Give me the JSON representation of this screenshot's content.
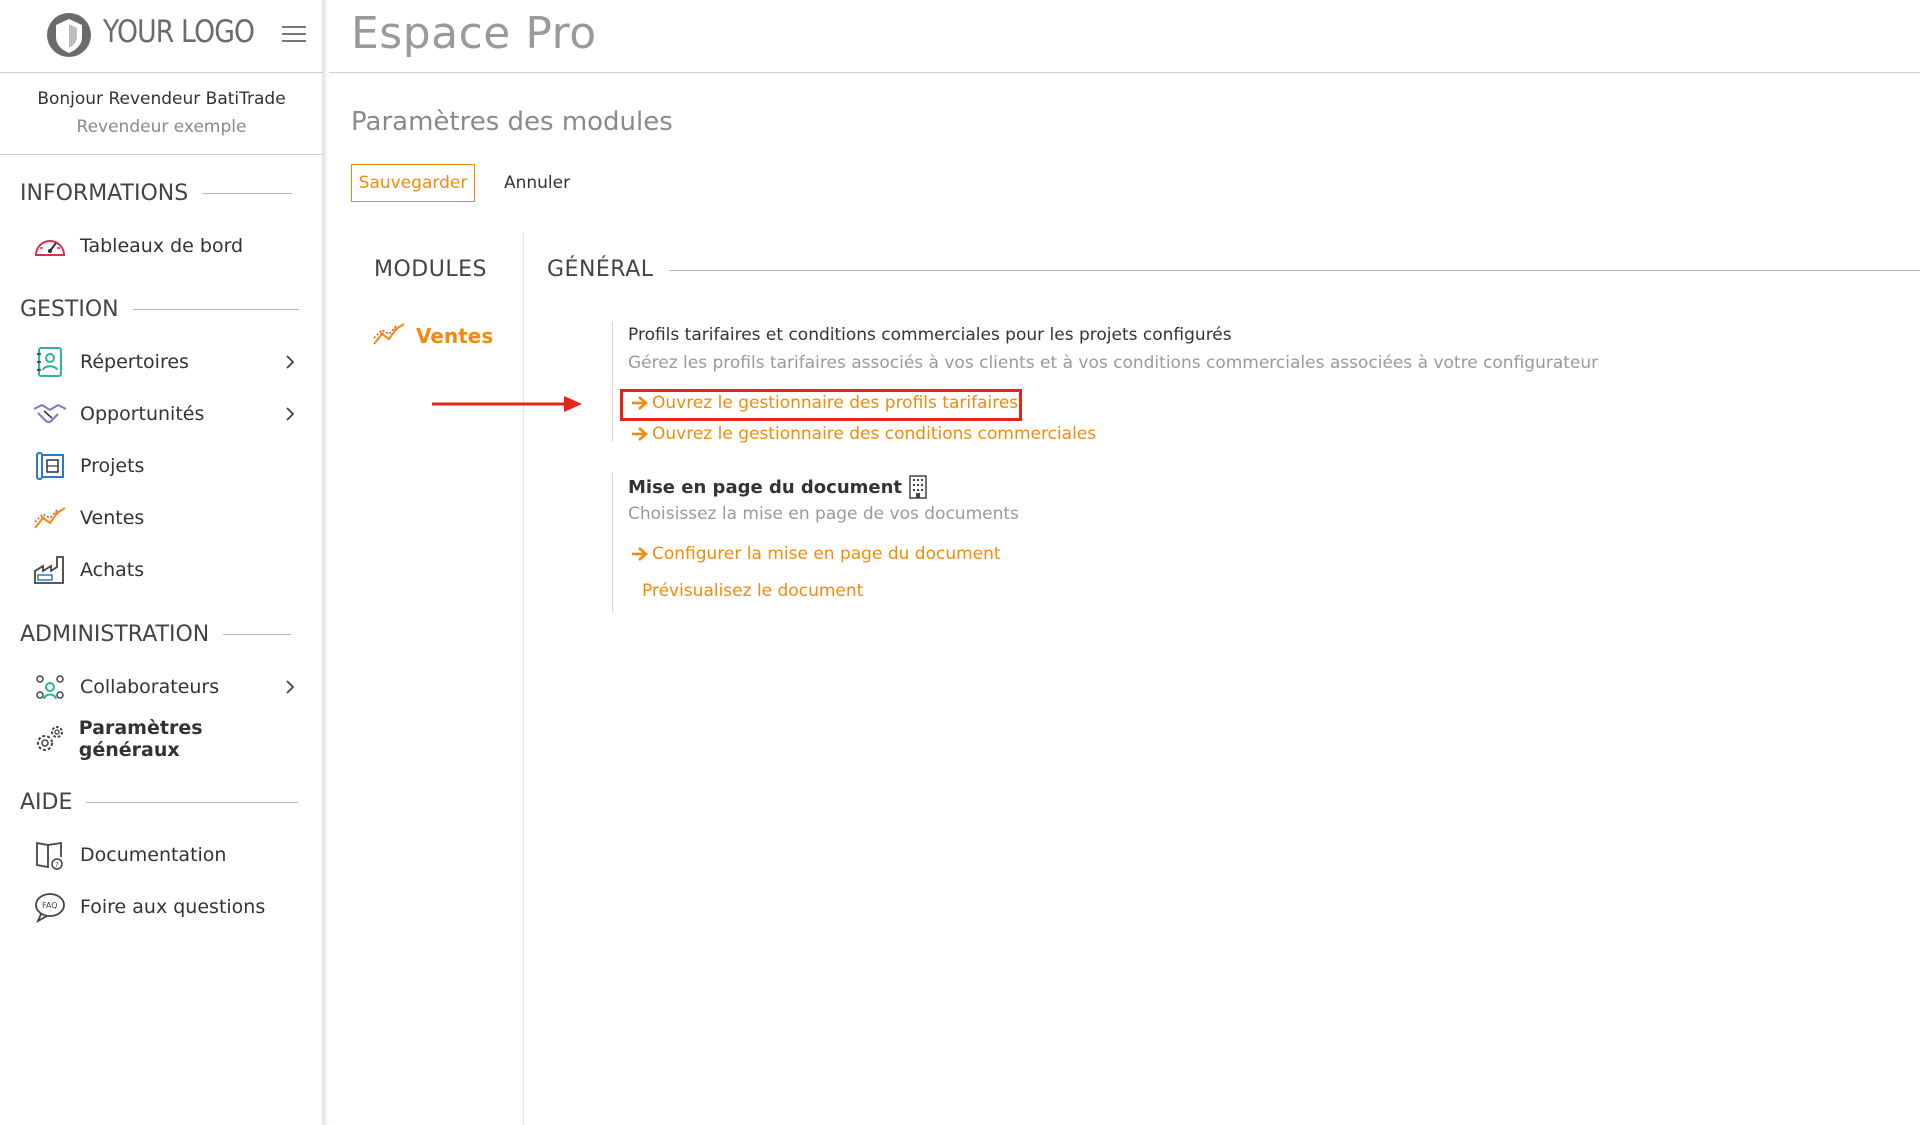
{
  "brand": {
    "logo_text": "YOUR LOGO",
    "logo_mark_color": "#6b6b6b",
    "accent_color": "#f28b0c",
    "highlight_color": "#e8241a"
  },
  "header": {
    "app_title": "Espace Pro",
    "menu_icon": "hamburger-icon"
  },
  "user": {
    "greeting": "Bonjour Revendeur BatiTrade",
    "subtitle": "Revendeur exemple"
  },
  "sidebar": {
    "sections": [
      {
        "title": "INFORMATIONS",
        "items": [
          {
            "label": "Tableaux de bord",
            "icon": "dashboard-gauge-icon",
            "has_chevron": false
          }
        ]
      },
      {
        "title": "GESTION",
        "items": [
          {
            "label": "Répertoires",
            "icon": "contacts-book-icon",
            "has_chevron": true
          },
          {
            "label": "Opportunités",
            "icon": "handshake-icon",
            "has_chevron": true
          },
          {
            "label": "Projets",
            "icon": "blueprint-icon",
            "has_chevron": false
          },
          {
            "label": "Ventes",
            "icon": "sales-trend-icon",
            "has_chevron": false
          },
          {
            "label": "Achats",
            "icon": "factory-icon",
            "has_chevron": false
          }
        ]
      },
      {
        "title": "ADMINISTRATION",
        "items": [
          {
            "label": "Collaborateurs",
            "icon": "team-icon",
            "has_chevron": true
          },
          {
            "label": "Paramètres généraux",
            "icon": "gears-icon",
            "has_chevron": false
          }
        ]
      },
      {
        "title": "AIDE",
        "items": [
          {
            "label": "Documentation",
            "icon": "book-help-icon",
            "has_chevron": false
          },
          {
            "label": "Foire aux questions",
            "icon": "faq-bubble-icon",
            "has_chevron": false
          }
        ]
      }
    ]
  },
  "main": {
    "page_title": "Paramètres des modules",
    "save_label": "Sauvegarder",
    "cancel_label": "Annuler",
    "modules_title": "MODULES",
    "modules": [
      {
        "label": "Ventes",
        "icon": "sales-trend-icon",
        "active": true
      }
    ],
    "general_title": "GÉNÉRAL",
    "blocks": [
      {
        "title": "Profils tarifaires et conditions commerciales pour les projets configurés",
        "subtitle": "Gérez les profils tarifaires associés à vos clients et à vos conditions commerciales associées à votre configurateur",
        "links": [
          {
            "label": "Ouvrez le gestionnaire des profils tarifaires",
            "icon": "arrow-right-icon",
            "highlighted": true
          },
          {
            "label": "Ouvrez le gestionnaire des conditions commerciales",
            "icon": "arrow-right-icon",
            "highlighted": false
          }
        ]
      },
      {
        "title": "Mise en page du document",
        "title_icon": "building-icon",
        "subtitle": "Choisissez la mise en page de vos documents",
        "links": [
          {
            "label": "Configurer la mise en page du document",
            "icon": "arrow-right-icon"
          },
          {
            "label": "Prévisualisez le document"
          }
        ]
      }
    ]
  }
}
